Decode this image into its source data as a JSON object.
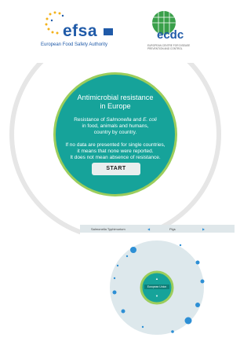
{
  "header": {
    "efsa_wordmark": "efsa",
    "efsa_subtitle": "European Food Safety Authority",
    "ecdc_wordmark": "ecdc",
    "ecdc_subtitle": "EUROPEAN CENTRE FOR DISEASE PREVENTION AND CONTROL"
  },
  "intro": {
    "title_line1": "Antimicrobial resistance",
    "title_line2": "in Europe",
    "para1_prefix": "Resistance of ",
    "para1_species1": "Salmonella",
    "para1_and": " and ",
    "para1_species2": "E. coli",
    "para1_line2": "in food, animals and humans,",
    "para1_line3": "country by country.",
    "para2_line1": "If no data are presented for single countries,",
    "para2_line2": "it means that none were reported.",
    "para2_line3": "It does not mean absence of resistance.",
    "start_label": "START"
  },
  "preview": {
    "selector1": "Salmonella Typhimurium",
    "selector2": "Pigs",
    "center_label": "European Union",
    "colors": {
      "teal": "#16a39a",
      "ring": "#9ccd5c",
      "dot": "#2d8fd5"
    }
  }
}
